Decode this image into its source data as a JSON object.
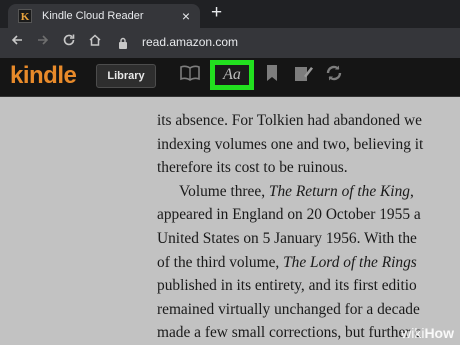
{
  "browser": {
    "tab_title": "Kindle Cloud Reader",
    "tab_close": "×",
    "new_tab": "+",
    "url": "read.amazon.com"
  },
  "kindle": {
    "logo": "kindle",
    "library_label": "Library",
    "font_button_label": "Aa",
    "highlight_color": "#22e01f"
  },
  "book": {
    "lines": [
      "its absence. For Tolkien had abandoned we",
      "indexing volumes one and two, believing it",
      "therefore its cost to be ruinous.",
      "Volume three, The Return of the King, ",
      "appeared in England on 20 October 1955 a",
      "United States on 5 January 1956. With the",
      "of the third volume, The Lord of the Rings",
      "published in its entirety, and its first editio",
      "remained virtually unchanged for a decade",
      "made a few small corrections, but further c"
    ]
  },
  "watermark": {
    "prefix": "wiki",
    "suffix": "How"
  }
}
